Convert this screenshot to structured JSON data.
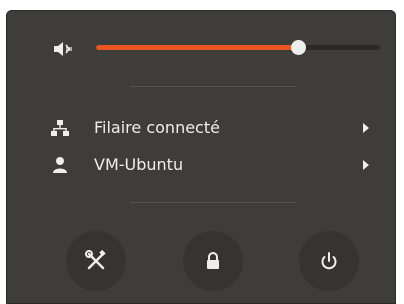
{
  "volume": {
    "icon": "speaker-muted-low-icon",
    "level_percent": 71
  },
  "menu_items": [
    {
      "icon": "network-wired-icon",
      "label": "Filaire connecté",
      "submenu": "chevron-right-icon"
    },
    {
      "icon": "user-icon",
      "label": "VM-Ubuntu",
      "submenu": "chevron-right-icon"
    }
  ],
  "actions": [
    {
      "icon": "settings-tools-icon"
    },
    {
      "icon": "lock-icon"
    },
    {
      "icon": "power-icon"
    }
  ],
  "colors": {
    "menu_background": "#3f3d39",
    "slider_fill": "#e95420",
    "slider_track": "#2a2926",
    "text": "#eeeeec",
    "button_background": "#353431"
  }
}
